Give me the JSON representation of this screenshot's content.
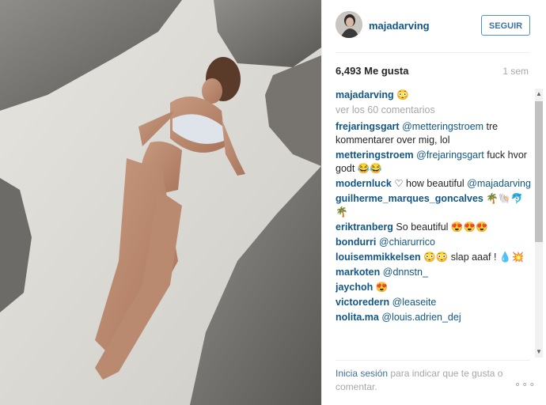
{
  "header": {
    "username": "majadarving",
    "follow_label": "SEGUIR"
  },
  "stats": {
    "likes": "6,493 Me gusta",
    "time": "1 sem"
  },
  "caption": {
    "username": "majadarving",
    "text": "😳"
  },
  "view_comments": "ver los 60 comentarios",
  "comments": [
    {
      "user": "frejaringsgart",
      "mention": "@metteringstroem",
      "text": " tre kommentarer over mig, lol"
    },
    {
      "user": "metteringstroem",
      "mention": "@frejaringsgart",
      "text": " fuck hvor godt 😂😂"
    },
    {
      "user": "modernluck",
      "mention": "",
      "text": " ♡ how beautiful "
    },
    {
      "user": "guilherme_marques_goncalves",
      "mention": "",
      "text": " 🌴🐚🐬🌴"
    },
    {
      "user": "eriktranberg",
      "mention": "",
      "text": " So beautiful 😍😍😍"
    },
    {
      "user": "bondurri",
      "mention": "@chiarurrico",
      "text": ""
    },
    {
      "user": "louisemmikkelsen",
      "mention": "",
      "text": " 😳😳 slap aaaf ! 💧💥"
    },
    {
      "user": "markoten",
      "mention": "@dnnstn_",
      "text": ""
    },
    {
      "user": "jaychoh",
      "mention": "",
      "text": " 😍"
    },
    {
      "user": "victoredern",
      "mention": "@leaseite",
      "text": ""
    },
    {
      "user": "nolita.ma",
      "mention": "@louis.adrien_dej",
      "text": ""
    }
  ],
  "modernluck_mention": "@majadarving",
  "footer": {
    "login_link": "Inicia sesión",
    "text": " para indicar que te gusta o comentar.",
    "more": "∘∘∘"
  }
}
